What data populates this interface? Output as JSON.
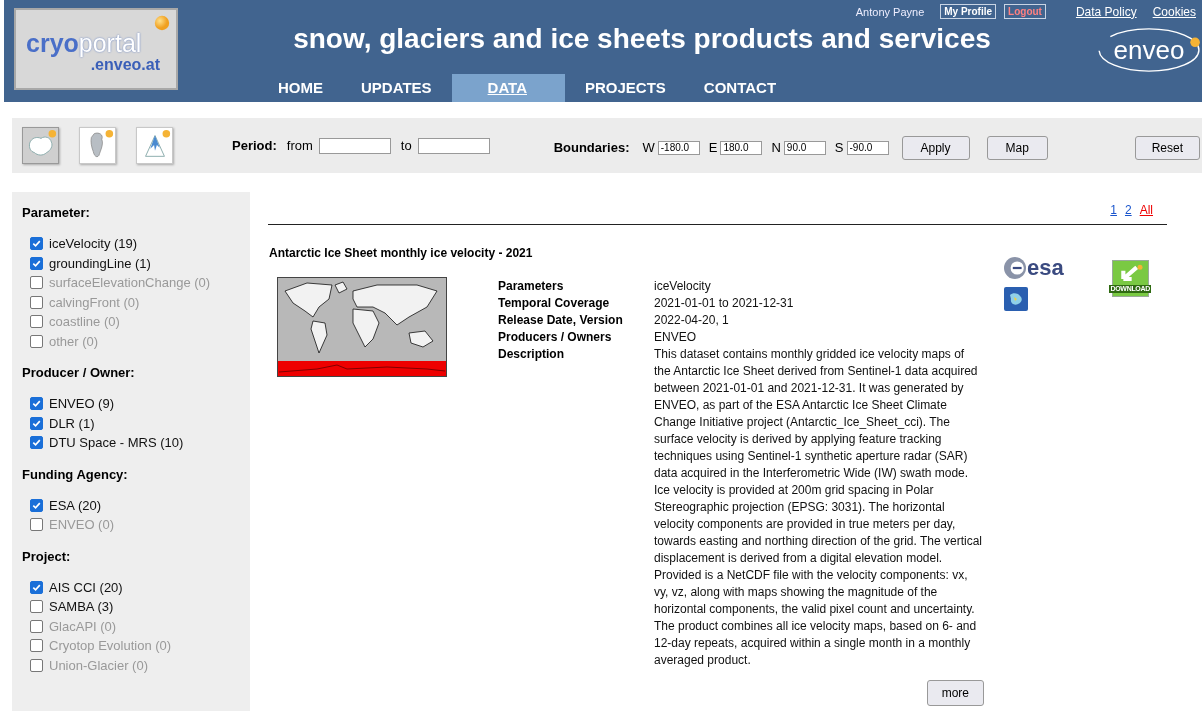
{
  "header": {
    "logo": {
      "part1": "cryo",
      "part2": "portal",
      "domain": ".enveo.at"
    },
    "title": "snow, glaciers and ice sheets products and services",
    "user_bar": {
      "user": "Antony Payne",
      "links": [
        {
          "label": "My Profile",
          "kind": "boxed"
        },
        {
          "label": "Logout",
          "kind": "alert"
        },
        {
          "label": "Data Policy",
          "kind": "link"
        },
        {
          "label": "Cookies",
          "kind": "link"
        }
      ]
    },
    "partner_logo": "enveo",
    "nav": [
      {
        "label": "HOME",
        "selected": false
      },
      {
        "label": "UPDATES",
        "selected": false
      },
      {
        "label": "DATA",
        "selected": true
      },
      {
        "label": "PROJECTS",
        "selected": false
      },
      {
        "label": "CONTACT",
        "selected": false
      }
    ]
  },
  "toolbar": {
    "regions": [
      {
        "kind": "antarctica",
        "selected": true
      },
      {
        "kind": "greenland",
        "selected": false
      },
      {
        "kind": "mountain",
        "selected": false
      }
    ],
    "period": {
      "label": "Period:",
      "from": "from",
      "to": "to"
    },
    "boundaries": {
      "label": "Boundaries:",
      "fields": [
        {
          "label": "W",
          "value": "-180.0"
        },
        {
          "label": "E",
          "value": "180.0"
        },
        {
          "label": "N",
          "value": "90.0"
        },
        {
          "label": "S",
          "value": "-90.0"
        }
      ],
      "buttons": [
        "Apply",
        "Map"
      ]
    },
    "reset": "Reset"
  },
  "filters": [
    {
      "title": "Parameter:",
      "items": [
        {
          "label": "iceVelocity (19)",
          "checked": true,
          "disabled": false
        },
        {
          "label": "groundingLine (1)",
          "checked": true,
          "disabled": false
        },
        {
          "label": "surfaceElevationChange (0)",
          "checked": false,
          "disabled": true
        },
        {
          "label": "calvingFront (0)",
          "checked": false,
          "disabled": true
        },
        {
          "label": "coastline (0)",
          "checked": false,
          "disabled": true
        },
        {
          "label": "other (0)",
          "checked": false,
          "disabled": true
        }
      ]
    },
    {
      "title": "Producer / Owner:",
      "items": [
        {
          "label": "ENVEO (9)",
          "checked": true,
          "disabled": false
        },
        {
          "label": "DLR (1)",
          "checked": true,
          "disabled": false
        },
        {
          "label": "DTU Space - MRS (10)",
          "checked": true,
          "disabled": false
        }
      ]
    },
    {
      "title": "Funding Agency:",
      "items": [
        {
          "label": "ESA (20)",
          "checked": true,
          "disabled": false
        },
        {
          "label": "ENVEO (0)",
          "checked": false,
          "disabled": true
        }
      ]
    },
    {
      "title": "Project:",
      "items": [
        {
          "label": "AIS CCI (20)",
          "checked": true,
          "disabled": false
        },
        {
          "label": "SAMBA (3)",
          "checked": false,
          "disabled": false
        },
        {
          "label": "GlacAPI (0)",
          "checked": false,
          "disabled": true
        },
        {
          "label": "Cryotop Evolution (0)",
          "checked": false,
          "disabled": true
        },
        {
          "label": "Union-Glacier (0)",
          "checked": false,
          "disabled": true
        }
      ]
    }
  ],
  "pagination": [
    {
      "label": "1",
      "selected": false
    },
    {
      "label": "2",
      "selected": false
    },
    {
      "label": "All",
      "selected": true
    }
  ],
  "result": {
    "title": "Antarctic Ice Sheet monthly ice velocity - 2021",
    "details": [
      {
        "label": "Parameters",
        "value": "iceVelocity"
      },
      {
        "label": "Temporal Coverage",
        "value": "2021-01-01 to 2021-12-31"
      },
      {
        "label": "Release Date, Version",
        "value": "2022-04-20, 1"
      },
      {
        "label": "Producers / Owners",
        "value": "ENVEO"
      },
      {
        "label": "Description",
        "value": "This dataset contains monthly gridded ice velocity maps of the Antarctic Ice Sheet derived from Sentinel-1 data acquired between 2021-01-01 and 2021-12-31. It was generated by ENVEO, as part of the ESA Antarctic Ice Sheet Climate Change Initiative project (Antarctic_Ice_Sheet_cci). The surface velocity is derived by applying feature tracking techniques using Sentinel-1 synthetic aperture radar (SAR) data acquired in the Interferometric Wide (IW) swath mode. Ice velocity is provided at 200m grid spacing in Polar Stereographic projection (EPSG: 3031). The horizontal velocity components are provided in true meters per day, towards easting and northing direction of the grid. The vertical displacement is derived from a digital elevation model. Provided is a NetCDF file with the velocity components: vx, vy, vz, along with maps showing the magnitude of the horizontal components, the valid pixel count and uncertainty. The product combines all ice velocity maps, based on 6- and 12-day repeats, acquired within a single month in a monthly averaged product."
      }
    ],
    "agency_logo": "esa",
    "download_label": "DOWNLOAD",
    "more": "more"
  }
}
